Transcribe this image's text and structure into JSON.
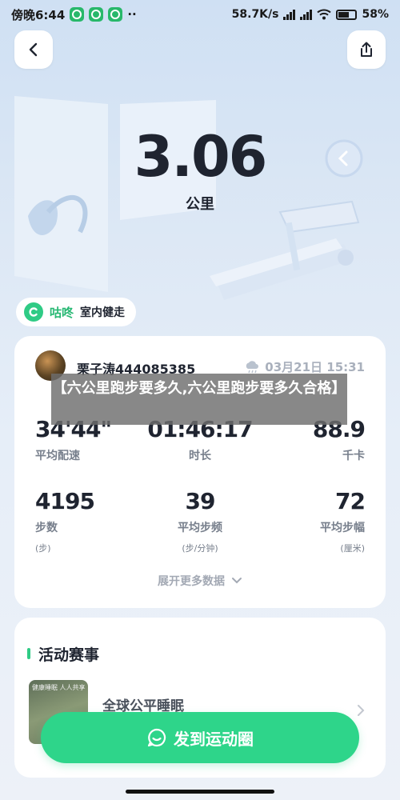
{
  "status_bar": {
    "carrier_time": "傍晚6:44",
    "app_icons": [
      "app-icon",
      "app-icon",
      "app-icon"
    ],
    "more": "··",
    "network_speed": "58.7K/s",
    "signal_1": "HD",
    "signal_2": "HD",
    "battery": "58%"
  },
  "header": {
    "back_icon": "chevron-left-icon",
    "share_icon": "share-icon"
  },
  "summary": {
    "distance": "3.06",
    "distance_unit": "公里",
    "source_brand": "咕咚",
    "source_mode": "室内健走"
  },
  "record": {
    "user_name": "栗子涛444085385",
    "weather_icon": "cloud-rain-icon",
    "time": "03月21日 15:31",
    "stats": [
      {
        "value": "34'44\"",
        "label": "平均配速",
        "unit": ""
      },
      {
        "value": "01:46:17",
        "label": "时长",
        "unit": ""
      },
      {
        "value": "88.9",
        "label": "千卡",
        "unit": ""
      },
      {
        "value": "4195",
        "label": "步数",
        "unit": "(步)"
      },
      {
        "value": "39",
        "label": "平均步频",
        "unit": "(步/分钟)"
      },
      {
        "value": "72",
        "label": "平均步幅",
        "unit": "(厘米)"
      }
    ],
    "expand_more": "展开更多数据"
  },
  "caption_overlay": "【六公里跑步要多久,六公里跑步要多久合格】",
  "events": {
    "title": "活动赛事",
    "item_name": "全球公平睡眠",
    "thumb_text": "健康睡眠 人人共享"
  },
  "share_cta": "发到运动圈",
  "colors": {
    "accent_green": "#2ed58a",
    "brand_green": "#27b873",
    "text_dark": "#1f2430",
    "text_muted": "#777f8c"
  }
}
